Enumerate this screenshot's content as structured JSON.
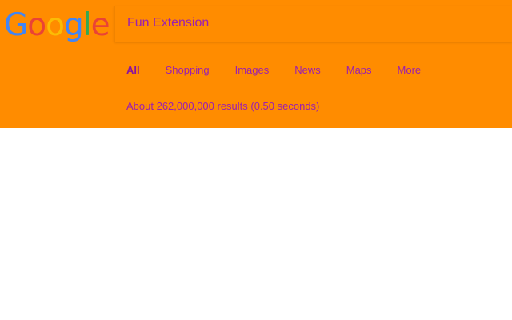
{
  "logo": {
    "letters": [
      {
        "char": "G",
        "color": "#4285f4"
      },
      {
        "char": "o",
        "color": "#ea4335"
      },
      {
        "char": "o",
        "color": "#fbbc05"
      },
      {
        "char": "g",
        "color": "#4285f4"
      },
      {
        "char": "l",
        "color": "#34a853"
      },
      {
        "char": "e",
        "color": "#ea4335"
      }
    ]
  },
  "search": {
    "value": "Fun Extension"
  },
  "tabs": [
    {
      "label": "All",
      "active": true
    },
    {
      "label": "Shopping",
      "active": false
    },
    {
      "label": "Images",
      "active": false
    },
    {
      "label": "News",
      "active": false
    },
    {
      "label": "Maps",
      "active": false
    },
    {
      "label": "More",
      "active": false
    }
  ],
  "result_stats": "About 262,000,000 results (0.50 seconds)",
  "colors": {
    "header_background": "#ff8c00",
    "text_accent": "#9b1fb0",
    "page_background": "#ffffff"
  }
}
